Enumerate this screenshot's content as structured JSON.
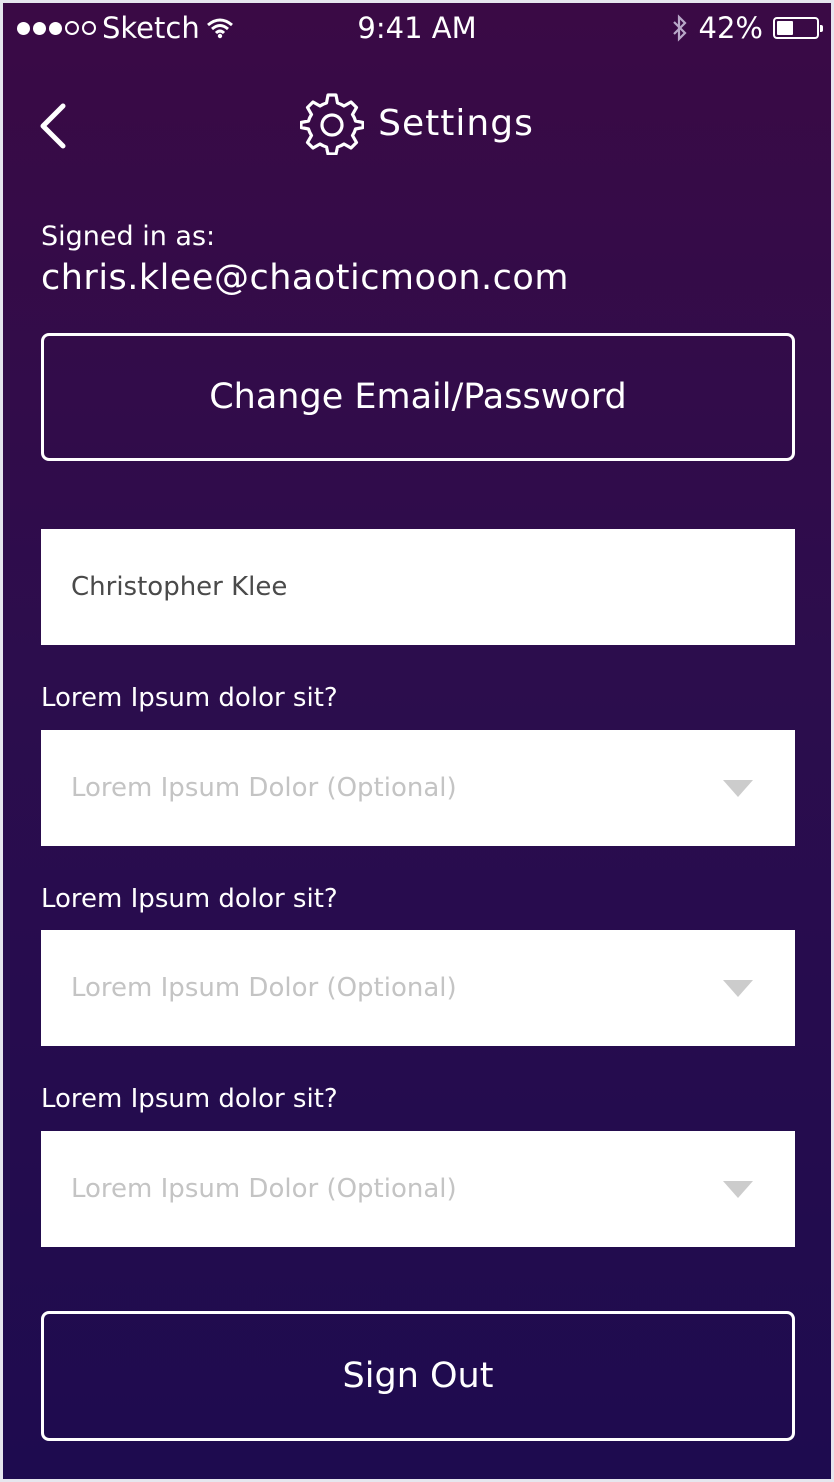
{
  "status_bar": {
    "carrier": "Sketch",
    "time": "9:41 AM",
    "battery_percent": "42%",
    "battery_level": 0.42
  },
  "header": {
    "title": "Settings",
    "back_icon": "chevron-left-icon",
    "title_icon": "gear-icon"
  },
  "account": {
    "signed_in_label": "Signed in as:",
    "email": "chris.klee@chaoticmoon.com",
    "change_button_label": "Change Email/Password"
  },
  "form": {
    "name_value": "Christopher Klee",
    "selects": [
      {
        "label": "Lorem Ipsum dolor sit?",
        "placeholder": "Lorem Ipsum Dolor (Optional)"
      },
      {
        "label": "Lorem Ipsum dolor sit?",
        "placeholder": "Lorem Ipsum Dolor (Optional)"
      },
      {
        "label": "Lorem Ipsum dolor sit?",
        "placeholder": "Lorem Ipsum Dolor (Optional)"
      }
    ]
  },
  "footer": {
    "sign_out_label": "Sign Out"
  },
  "colors": {
    "background_top": "#3a0a45",
    "background_bottom": "#1e0b4f",
    "placeholder": "#c4c4c4",
    "field_text": "#4a4a4a"
  }
}
